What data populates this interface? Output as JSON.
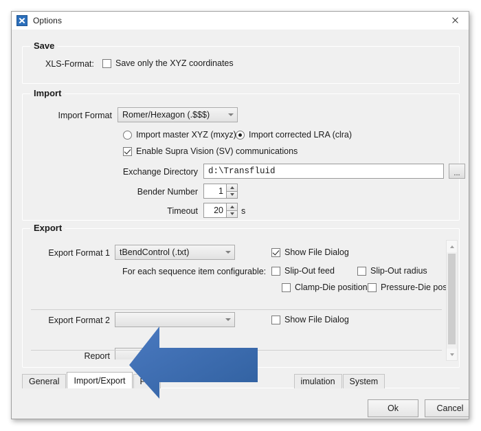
{
  "window": {
    "title": "Options",
    "icon": "tools-icon",
    "close_icon": "close-icon"
  },
  "save_group": {
    "title": "Save",
    "xls_label": "XLS-Format:",
    "xls_checkbox": {
      "label": "Save only the XYZ coordinates",
      "checked": false
    }
  },
  "import_group": {
    "title": "Import",
    "import_format_label": "Import Format",
    "import_format_value": "Romer/Hexagon (.$$$)",
    "radio_master": {
      "label": "Import master XYZ (mxyz)",
      "checked": false
    },
    "radio_corrected": {
      "label": "Import corrected LRA (clra)",
      "checked": true
    },
    "supra_vision": {
      "label": "Enable Supra Vision (SV) communications",
      "checked": true
    },
    "exchange_dir_label": "Exchange Directory",
    "exchange_dir_value": "d:\\Transfluid",
    "browse_label": "...",
    "bender_label": "Bender Number",
    "bender_value": "1",
    "timeout_label": "Timeout",
    "timeout_value": "20",
    "timeout_unit": "s"
  },
  "export_group": {
    "title": "Export",
    "format1_label": "Export Format 1",
    "format1_value": "tBendControl (.txt)",
    "format1_show_dialog": {
      "label": "Show File Dialog",
      "checked": true
    },
    "sequence_note": "For each sequence item configurable:",
    "slip_out_feed": {
      "label": "Slip-Out feed",
      "checked": false
    },
    "slip_out_radius": {
      "label": "Slip-Out radius",
      "checked": false
    },
    "clamp_die": {
      "label": "Clamp-Die position",
      "checked": false
    },
    "pressure_die": {
      "label": "Pressure-Die position",
      "checked": false
    },
    "format2_label": "Export Format 2",
    "format2_value": "",
    "format2_show_dialog": {
      "label": "Show File Dialog",
      "checked": false
    },
    "report_label": "Report",
    "report_value": ""
  },
  "tabs": [
    {
      "label": "General",
      "active": false
    },
    {
      "label": "Import/Export",
      "active": true
    },
    {
      "label": "Pr",
      "active": false
    },
    {
      "label": "imulation",
      "active": false
    },
    {
      "label": "System",
      "active": false
    }
  ],
  "buttons": {
    "ok": "Ok",
    "cancel": "Cancel"
  },
  "annotation": {
    "type": "arrow-left",
    "color": "#3b6cb5"
  }
}
